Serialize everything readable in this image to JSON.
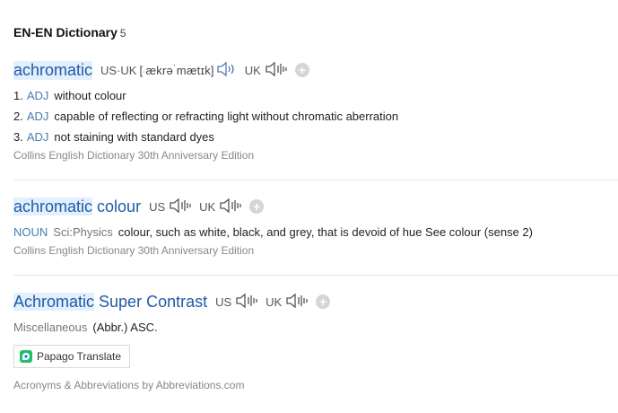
{
  "header": {
    "title": "EN-EN Dictionary",
    "count": "5"
  },
  "entries": [
    {
      "word": "achromatic",
      "pron": {
        "us_uk_label": "US·UK",
        "ipa_pre": "[",
        "ipa_a": "ækrə",
        "ipa_b": "mætɪk]",
        "uk_label": "UK"
      },
      "senses": [
        {
          "num": "1.",
          "pos": "ADJ",
          "text": "without colour"
        },
        {
          "num": "2.",
          "pos": "ADJ",
          "text": "capable of reflecting or refracting light without chromatic aberration"
        },
        {
          "num": "3.",
          "pos": "ADJ",
          "text": "not staining with standard dyes"
        }
      ],
      "source": "Collins English Dictionary 30th Anniversary Edition"
    },
    {
      "word_hl": "achromatic",
      "word_rest": " colour",
      "pron": {
        "us_label": "US",
        "uk_label": "UK"
      },
      "sense": {
        "pos": "NOUN",
        "field": "Sci:Physics",
        "text": "colour, such as white, black, and grey, that is devoid of hue See colour (sense 2)"
      },
      "source": "Collins English Dictionary 30th Anniversary Edition"
    },
    {
      "word_hl": "Achromatic",
      "word_rest": " Super Contrast",
      "pron": {
        "us_label": "US",
        "uk_label": "UK"
      },
      "sense": {
        "category": "Miscellaneous",
        "text": "(Abbr.) ASC."
      },
      "translate_button": "Papago Translate",
      "source": "Acronyms & Abbreviations by Abbreviations.com"
    }
  ],
  "icons": {
    "speaker": "speaker-icon",
    "add": "plus-circle-icon",
    "papago": "papago-logo"
  },
  "colors": {
    "headword": "#1f5aa8",
    "highlight": "#e3effc",
    "pos": "#4b7ab5",
    "source": "#888888"
  }
}
